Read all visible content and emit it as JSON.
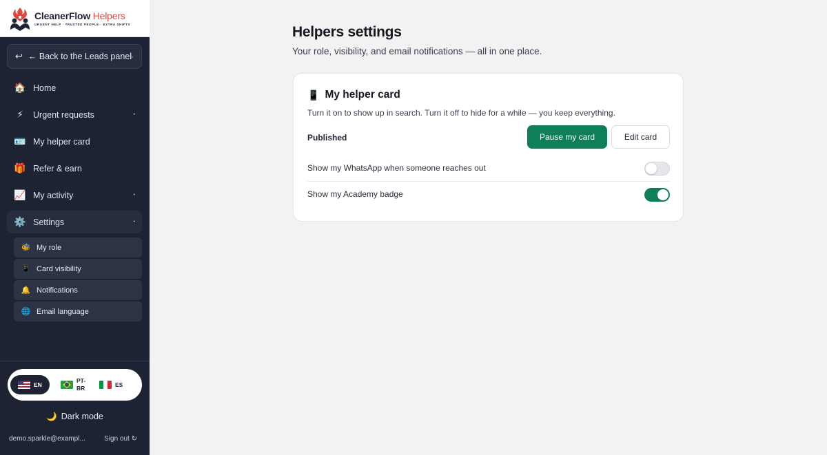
{
  "brand": {
    "name": "CleanerFlow",
    "name_accent": "Helpers",
    "tagline": "URGENT HELP · TRUSTED PEOPLE · EXTRA SHIFTS",
    "colors": {
      "accent": "#e0473e",
      "sidebar": "#1d2333",
      "primary": "#0f7e5b"
    }
  },
  "sidebar": {
    "back_label": "← Back to the Leads panel",
    "nav": [
      {
        "label": "Home",
        "icon": "🏠"
      },
      {
        "label": "Urgent requests",
        "icon": "⚡"
      },
      {
        "label": "My helper card",
        "icon": "🪪"
      },
      {
        "label": "Refer & earn",
        "icon": "🎁"
      },
      {
        "label": "My activity",
        "icon": "📈"
      },
      {
        "label": "Settings",
        "icon": "⚙️"
      }
    ],
    "settings_sub": [
      {
        "label": "My role",
        "icon": "🐝"
      },
      {
        "label": "Card visibility",
        "icon": "📱"
      },
      {
        "label": "Notifications",
        "icon": "🔔"
      },
      {
        "label": "Email language",
        "icon": "🌐"
      }
    ],
    "languages": [
      {
        "code": "EN",
        "active": true
      },
      {
        "code": "PT-BR",
        "line1": "PT-",
        "line2": "BR",
        "active": false
      },
      {
        "code": "ES",
        "active": false
      }
    ],
    "dark_mode_label": "Dark mode",
    "user_email": "demo.sparkle@exampl...",
    "sign_out_label": "Sign out"
  },
  "main": {
    "title": "Helpers settings",
    "subtitle": "Your role, visibility, and email notifications — all in one place.",
    "card": {
      "icon": "📱",
      "title": "My helper card",
      "description": "Turn it on to show up in search. Turn it off to hide for a while — you keep everything.",
      "status": "Published",
      "pause_label": "Pause my card",
      "edit_label": "Edit card",
      "whatsapp_label": "Show my WhatsApp when someone reaches out",
      "whatsapp_on": false,
      "badge_label": "Show my Academy badge",
      "badge_on": true
    }
  }
}
